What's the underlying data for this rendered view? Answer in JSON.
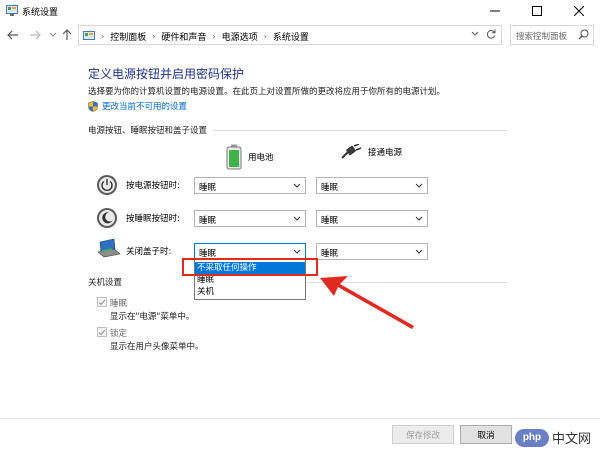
{
  "window": {
    "title": "系统设置",
    "minimize_icon": "minimize-icon",
    "maximize_icon": "maximize-icon",
    "close_icon": "close-icon"
  },
  "address_bar": {
    "breadcrumbs": [
      "控制面板",
      "硬件和声音",
      "电源选项",
      "系统设置"
    ],
    "search_placeholder": "搜索控制面板"
  },
  "content": {
    "title": "定义电源按钮并启用密码保护",
    "description": "选择要为你的计算机设置的电源设置。在此页上对设置所做的更改将应用于你所有的电源计划。",
    "change_link": "更改当前不可用的设置",
    "power_section": "电源按钮、睡眠按钮和盖子设置",
    "col_battery": "用电池",
    "col_plugged": "接通电源",
    "rows": [
      {
        "label": "按电源按钮时:",
        "battery": "睡眠",
        "plugged": "睡眠"
      },
      {
        "label": "按睡眠按钮时:",
        "battery": "睡眠",
        "plugged": "睡眠"
      },
      {
        "label": "关闭盖子时:",
        "battery": "睡眠",
        "plugged": "睡眠"
      }
    ],
    "dropdown_options": [
      "不采取任何操作",
      "睡眠",
      "关机"
    ],
    "dropdown_selected": "不采取任何操作",
    "shutdown_section": "关机设置",
    "checkboxes": [
      {
        "label": "睡眠",
        "sub": "显示在\"电源\"菜单中。",
        "checked": true
      },
      {
        "label": "锁定",
        "sub": "显示在用户头像菜单中。",
        "checked": true
      }
    ]
  },
  "footer": {
    "save_label": "保存修改",
    "cancel_label": "取消"
  },
  "watermark": {
    "badge": "php",
    "text": "中文网"
  },
  "colors": {
    "title_blue": "#1e3287",
    "link_blue": "#0066cc",
    "selection_blue": "#0078d7",
    "annotation_red": "#e02a20"
  }
}
